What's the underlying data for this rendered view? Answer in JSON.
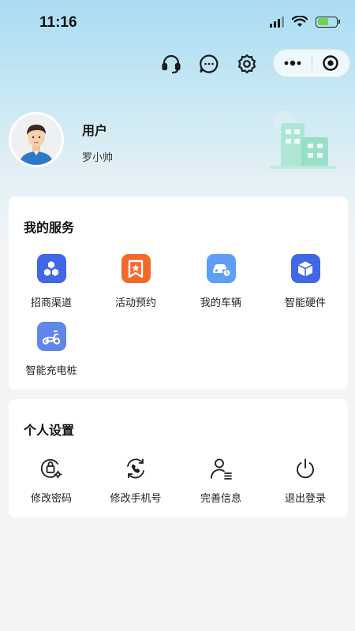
{
  "status_bar": {
    "time": "11:16",
    "battery_level": 0.6
  },
  "top_actions": {
    "icons": [
      "headset-icon",
      "chat-bubble-icon",
      "gear-icon",
      "more-dots-icon",
      "target-circle-icon"
    ]
  },
  "profile": {
    "name": "用户",
    "subtitle": "罗小帅"
  },
  "services": {
    "title": "我的服务",
    "items": [
      {
        "label": "招商渠道",
        "icon": "hexagon-cluster-icon",
        "color": "#3f67e6"
      },
      {
        "label": "活动预约",
        "icon": "bookmark-star-icon",
        "color": "#f26a2a"
      },
      {
        "label": "我的车辆",
        "icon": "car-icon",
        "color": "#5f9ef5"
      },
      {
        "label": "智能硬件",
        "icon": "cube-icon",
        "color": "#3f67e6"
      },
      {
        "label": "智能充电桩",
        "icon": "scooter-icon",
        "color": "#5f86e8"
      }
    ]
  },
  "settings": {
    "title": "个人设置",
    "items": [
      {
        "label": "修改密码",
        "icon": "lock-gear-icon"
      },
      {
        "label": "修改手机号",
        "icon": "phone-refresh-icon"
      },
      {
        "label": "完善信息",
        "icon": "person-list-icon"
      },
      {
        "label": "退出登录",
        "icon": "power-icon"
      }
    ]
  },
  "colors": {
    "background": "#f3f4f6",
    "header_gradient_top": "#a9dcf3",
    "card": "#ffffff"
  }
}
